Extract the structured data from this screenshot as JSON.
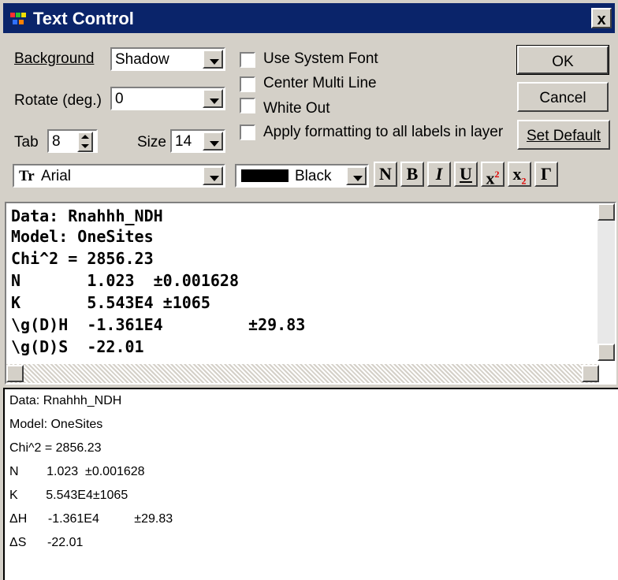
{
  "window": {
    "title": "Text Control",
    "close_glyph": "x"
  },
  "controls": {
    "background_label": "Background",
    "background_value": "Shadow",
    "rotate_label": "Rotate (deg.)",
    "rotate_value": "0",
    "tab_label": "Tab",
    "tab_value": "8",
    "size_label": "Size",
    "size_value": "14",
    "use_system_font_label": "Use System Font",
    "center_multi_line_label": "Center Multi Line",
    "white_out_label": "White Out",
    "apply_formatting_label": "Apply formatting to all labels in layer",
    "ok_label": "OK",
    "cancel_label": "Cancel",
    "set_default_label": "Set Default",
    "font_value": "Arial",
    "font_icon": "Tr",
    "color_value": "Black",
    "color_swatch": "#000000"
  },
  "format_buttons": {
    "normal": "N",
    "bold": "B",
    "italic": "I",
    "underline": "U",
    "superscript": "x",
    "superscript_mark": "2",
    "subscript": "x",
    "subscript_mark": "2",
    "greek": "Γ"
  },
  "editor_lines": [
    "Data: Rnahhh_NDH",
    "Model: OneSites",
    "Chi^2 = 2856.23",
    "N       1.023  ±0.001628",
    "K       5.543E4 ±1065",
    "\\g(D)H  -1.361E4         ±29.83",
    "\\g(D)S  -22.01"
  ],
  "preview_lines": [
    "Data: Rnahhh_NDH",
    "Model: OneSites",
    "Chi^2 = 2856.23",
    "N        1.023  ±0.001628",
    "K        5.543E4±1065",
    "ΔH      -1.361E4          ±29.83",
    "ΔS      -22.01"
  ]
}
